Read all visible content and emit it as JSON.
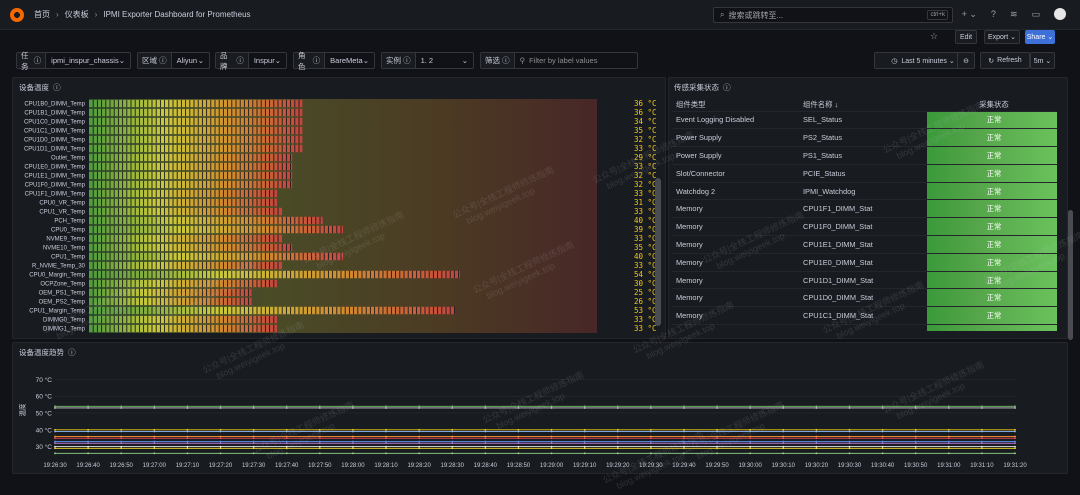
{
  "topbar": {
    "home": "首页",
    "dashboards": "仪表板",
    "dashboard_title": "IPMI Exporter Dashboard for Prometheus",
    "search_placeholder": "搜索或跳转至...",
    "search_shortcut": "ctrl+k",
    "plus": "+ ⌄"
  },
  "toolbar": {
    "edit": "Edit",
    "export": "Export ⌄",
    "share": "Share ⌄",
    "time_range": "Last 5 minutes ⌄",
    "refresh": "Refresh",
    "refresh_interval": "5m ⌄"
  },
  "variables": [
    {
      "label": "任务",
      "value": "ipmi_inspur_chassis"
    },
    {
      "label": "区域",
      "value": "Aliyun"
    },
    {
      "label": "品牌",
      "value": "Inspur"
    },
    {
      "label": "角色",
      "value": "BareMeta"
    },
    {
      "label": "实例",
      "value": "1.        2"
    },
    {
      "label": "筛选",
      "value": "Filter by label values"
    }
  ],
  "heatmap_panel": {
    "title": "设备温度",
    "rows": [
      {
        "name": "CPU1B0_DIMM_Temp",
        "value": "36 °C",
        "level": 0.42
      },
      {
        "name": "CPU1B1_DIMM_Temp",
        "value": "36 °C",
        "level": 0.42
      },
      {
        "name": "CPU1C0_DIMM_Temp",
        "value": "34 °C",
        "level": 0.42
      },
      {
        "name": "CPU1C1_DIMM_Temp",
        "value": "35 °C",
        "level": 0.42
      },
      {
        "name": "CPU1D0_DIMM_Temp",
        "value": "32 °C",
        "level": 0.42
      },
      {
        "name": "CPU1D1_DIMM_Temp",
        "value": "33 °C",
        "level": 0.42
      },
      {
        "name": "Outlet_Temp",
        "value": "29 °C",
        "level": 0.4
      },
      {
        "name": "CPU1E0_DIMM_Temp",
        "value": "33 °C",
        "level": 0.4
      },
      {
        "name": "CPU1E1_DIMM_Temp",
        "value": "32 °C",
        "level": 0.4
      },
      {
        "name": "CPU1F0_DIMM_Temp",
        "value": "32 °C",
        "level": 0.4
      },
      {
        "name": "CPU1F1_DIMM_Temp",
        "value": "33 °C",
        "level": 0.37
      },
      {
        "name": "CPU0_VR_Temp",
        "value": "31 °C",
        "level": 0.37
      },
      {
        "name": "CPU1_VR_Temp",
        "value": "33 °C",
        "level": 0.38
      },
      {
        "name": "PCH_Temp",
        "value": "40 °C",
        "level": 0.46
      },
      {
        "name": "CPU0_Temp",
        "value": "39 °C",
        "level": 0.5
      },
      {
        "name": "NVME9_Temp",
        "value": "33 °C",
        "level": 0.38
      },
      {
        "name": "NVME10_Temp",
        "value": "35 °C",
        "level": 0.4
      },
      {
        "name": "CPU1_Temp",
        "value": "40 °C",
        "level": 0.5
      },
      {
        "name": "R_NVME_Temp_30",
        "value": "33 °C",
        "level": 0.38
      },
      {
        "name": "CPU0_Margin_Temp",
        "value": "54 °C",
        "level": 0.73
      },
      {
        "name": "OCPZone_Temp",
        "value": "30 °C",
        "level": 0.37
      },
      {
        "name": "OEM_PS1_Temp",
        "value": "25 °C",
        "level": 0.32
      },
      {
        "name": "OEM_PS2_Temp",
        "value": "26 °C",
        "level": 0.32
      },
      {
        "name": "CPU1_Margin_Temp",
        "value": "53 °C",
        "level": 0.72
      },
      {
        "name": "DIMMG0_Temp",
        "value": "33 °C",
        "level": 0.37
      },
      {
        "name": "DIMMG1_Temp",
        "value": "33 °C",
        "level": 0.37
      }
    ]
  },
  "status_panel": {
    "title": "传感采集状态",
    "columns": [
      "组件类型",
      "组件名称 ↓",
      "采集状态"
    ],
    "rows": [
      [
        "Event Logging Disabled",
        "SEL_Status",
        "正常"
      ],
      [
        "Power Supply",
        "PS2_Status",
        "正常"
      ],
      [
        "Power Supply",
        "PS1_Status",
        "正常"
      ],
      [
        "Slot/Connector",
        "PCIE_Status",
        "正常"
      ],
      [
        "Watchdog 2",
        "IPMI_Watchdog",
        "正常"
      ],
      [
        "Memory",
        "CPU1F1_DIMM_Stat",
        "正常"
      ],
      [
        "Memory",
        "CPU1F0_DIMM_Stat",
        "正常"
      ],
      [
        "Memory",
        "CPU1E1_DIMM_Stat",
        "正常"
      ],
      [
        "Memory",
        "CPU1E0_DIMM_Stat",
        "正常"
      ],
      [
        "Memory",
        "CPU1D1_DIMM_Stat",
        "正常"
      ],
      [
        "Memory",
        "CPU1D0_DIMM_Stat",
        "正常"
      ],
      [
        "Memory",
        "CPU1C1_DIMM_Stat",
        "正常"
      ]
    ]
  },
  "trend_panel": {
    "title": "设备温度趋势",
    "ylabel": "温度"
  },
  "chart_data": {
    "type": "line",
    "title": "设备温度趋势",
    "ylabel": "温度",
    "y_ticks": [
      "70 °C",
      "60 °C",
      "50 °C",
      "40 °C",
      "30 °C"
    ],
    "ylim": [
      25,
      75
    ],
    "x": [
      "19:26:30",
      "19:26:40",
      "19:26:50",
      "19:27:00",
      "19:27:10",
      "19:27:20",
      "19:27:30",
      "19:27:40",
      "19:27:50",
      "19:28:00",
      "19:28:10",
      "19:28:20",
      "19:28:30",
      "19:28:40",
      "19:28:50",
      "19:29:00",
      "19:29:10",
      "19:29:20",
      "19:29:30",
      "19:29:40",
      "19:29:50",
      "19:30:00",
      "19:30:10",
      "19:30:20",
      "19:30:30",
      "19:30:40",
      "19:30:50",
      "19:31:00",
      "19:31:10",
      "19:31:20"
    ],
    "series": [
      {
        "values": [
          54,
          54,
          54,
          54,
          54,
          54,
          54,
          54,
          54,
          54,
          54,
          54,
          54,
          54,
          54,
          54,
          54,
          54,
          54,
          54,
          54,
          54,
          54,
          54,
          54,
          54,
          54,
          54,
          54,
          54
        ],
        "color": "#73bf69"
      },
      {
        "values": [
          53,
          53,
          53,
          53,
          53,
          53,
          53,
          53,
          53,
          53,
          53,
          53,
          53,
          53,
          53,
          53,
          53,
          53,
          53,
          53,
          53,
          53,
          53,
          53,
          53,
          53,
          53,
          53,
          53,
          53
        ],
        "color": "#c8c8d0"
      },
      {
        "values": [
          40,
          40,
          40,
          40,
          40,
          40,
          40,
          40,
          40,
          40,
          40,
          40,
          40,
          40,
          40,
          40,
          40,
          40,
          40,
          40,
          40,
          40,
          40,
          40,
          40,
          40,
          40,
          40,
          40,
          40
        ],
        "color": "#f2cc0c"
      },
      {
        "values": [
          39,
          39,
          39,
          39,
          39,
          39,
          39,
          39,
          39,
          39,
          39,
          39,
          39,
          39,
          39,
          39,
          39,
          39,
          39,
          39,
          39,
          39,
          39,
          39,
          39,
          39,
          39,
          39,
          39,
          39
        ],
        "color": "#8ab8ff"
      },
      {
        "values": [
          36,
          36,
          36,
          36,
          36,
          36,
          36,
          36,
          36,
          36,
          36,
          36,
          36,
          36,
          36,
          36,
          36,
          36,
          36,
          36,
          36,
          36,
          36,
          36,
          36,
          36,
          36,
          36,
          36,
          36
        ],
        "color": "#ff9830"
      },
      {
        "values": [
          35,
          35,
          35,
          35,
          35,
          35,
          35,
          35,
          35,
          35,
          35,
          35,
          35,
          35,
          35,
          35,
          35,
          35,
          35,
          35,
          35,
          35,
          35,
          35,
          35,
          35,
          35,
          35,
          35,
          35
        ],
        "color": "#f2495c"
      },
      {
        "values": [
          33,
          33,
          33,
          33,
          33,
          33,
          33,
          33,
          33,
          33,
          33,
          33,
          33,
          33,
          33,
          33,
          33,
          33,
          33,
          33,
          33,
          33,
          33,
          33,
          33,
          33,
          33,
          33,
          33,
          33
        ],
        "color": "#5794f2"
      },
      {
        "values": [
          32,
          32,
          32,
          32,
          32,
          32,
          32,
          32,
          32,
          32,
          32,
          32,
          32,
          32,
          32,
          32,
          32,
          32,
          32,
          32,
          32,
          32,
          32,
          32,
          32,
          32,
          32,
          32,
          32,
          32
        ],
        "color": "#b877d9"
      },
      {
        "values": [
          30,
          30,
          30,
          30,
          30,
          30,
          30,
          30,
          30,
          30,
          30,
          30,
          30,
          30,
          30,
          30,
          30,
          30,
          30,
          30,
          30,
          30,
          30,
          30,
          30,
          30,
          30,
          30,
          30,
          30
        ],
        "color": "#e0e0e0"
      },
      {
        "values": [
          29,
          29,
          29,
          29,
          29,
          29,
          29,
          29,
          29,
          29,
          29,
          29,
          29,
          29,
          29,
          29,
          29,
          29,
          29,
          29,
          29,
          29,
          29,
          29,
          29,
          29,
          29,
          29,
          29,
          29
        ],
        "color": "#fade2a"
      },
      {
        "values": [
          26,
          26,
          26,
          26,
          26,
          26,
          26,
          26,
          26,
          26,
          26,
          26,
          26,
          26,
          26,
          26,
          26,
          26,
          26,
          26,
          26,
          26,
          26,
          26,
          26,
          26,
          26,
          26,
          26,
          26
        ],
        "color": "#96d98d"
      }
    ]
  },
  "watermark": {
    "line1": "公众号|全栈工程师修炼指南",
    "line2": "blog.weiyigeek.top"
  }
}
